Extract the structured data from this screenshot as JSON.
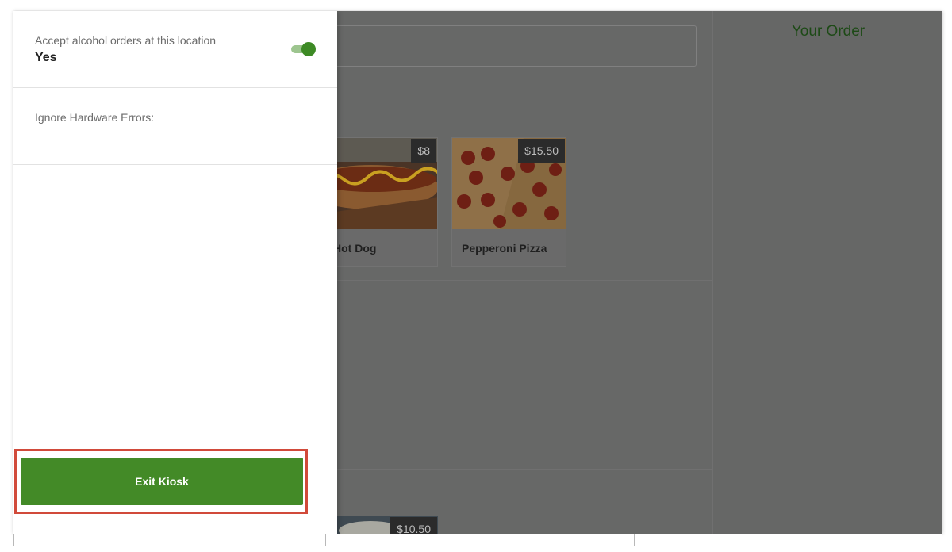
{
  "drawer": {
    "alcohol_setting": {
      "label": "Accept alcohol orders at this location",
      "value": "Yes",
      "toggle_on": true
    },
    "hardware_setting": {
      "label": "Ignore Hardware Errors:"
    },
    "exit_button_label": "Exit Kiosk"
  },
  "order_panel": {
    "title": "Your Order"
  },
  "products": [
    {
      "name": "Hot Dog",
      "price": "$8"
    },
    {
      "name": "Pepperoni Pizza",
      "price": "$15.50"
    },
    {
      "name": "",
      "price": "$10.50"
    }
  ],
  "colors": {
    "accent": "#438a27",
    "highlight": "#d14a3a",
    "overlay": "#676867"
  }
}
